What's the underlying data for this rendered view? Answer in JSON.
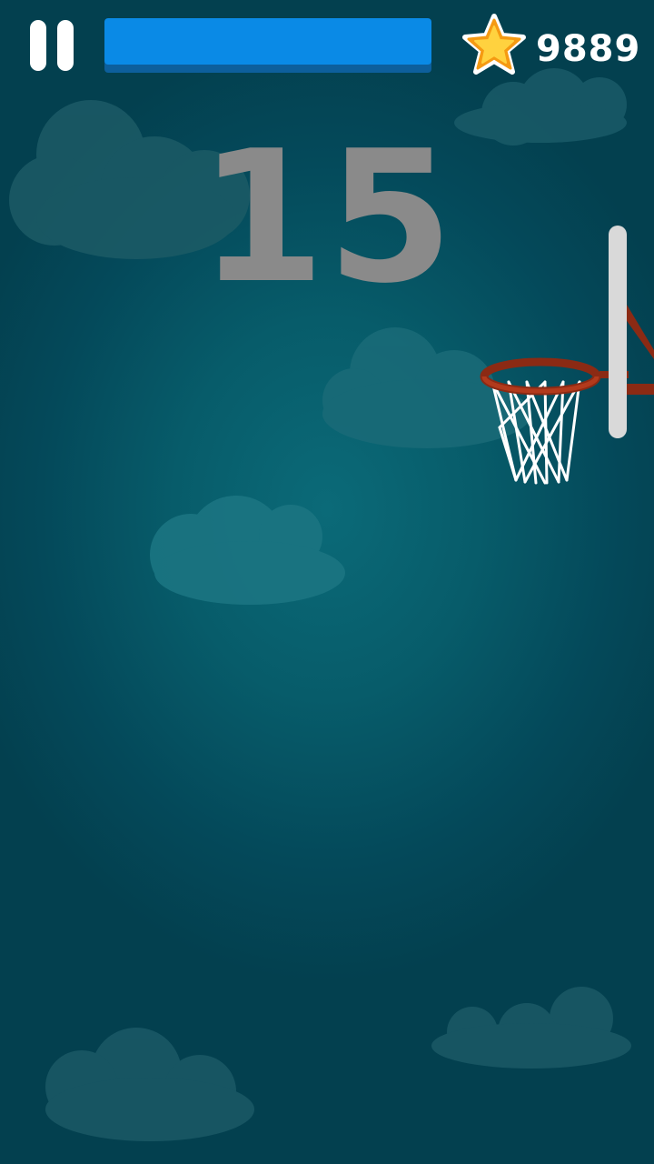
{
  "hud": {
    "coins": "9889",
    "timer_fraction": 1.0,
    "icons": {
      "pause": "pause-icon",
      "coin": "star-icon"
    }
  },
  "game": {
    "score": "15"
  },
  "colors": {
    "background": "#04495a",
    "timer_fill": "#0a8ae6",
    "score_text": "#8a8a8a",
    "rim": "#8b2a14",
    "star": "#ffd23f"
  }
}
